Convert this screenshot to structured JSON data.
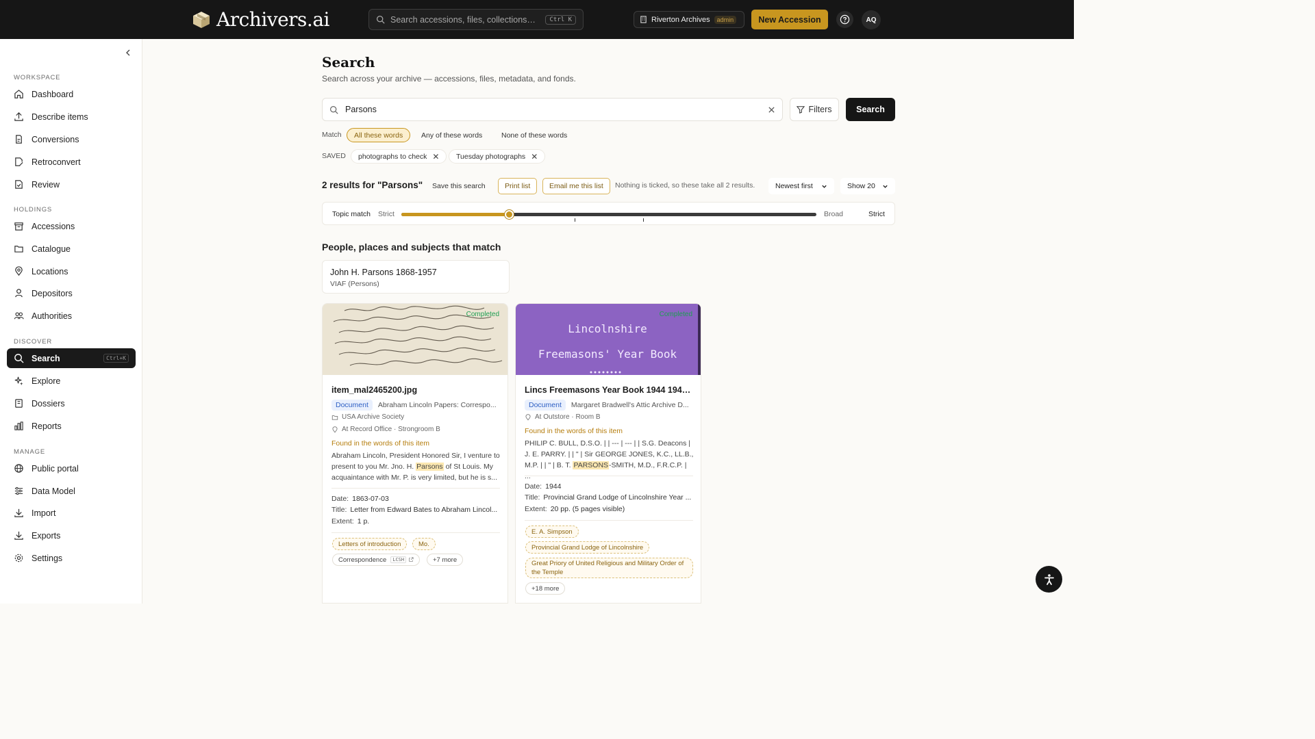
{
  "brand": {
    "name": "Archivers.ai"
  },
  "topbar": {
    "search_placeholder": "Search accessions, files, collections…",
    "search_shortcut": "Ctrl K",
    "org_name": "Riverton Archives",
    "org_role": "admin",
    "new_accession_label": "New Accession",
    "avatar_initials": "AQ"
  },
  "sidebar": {
    "sections": {
      "workspace": "WORKSPACE",
      "holdings": "HOLDINGS",
      "discover": "DISCOVER",
      "manage": "MANAGE"
    },
    "items": {
      "dashboard": "Dashboard",
      "describe": "Describe items",
      "conversions": "Conversions",
      "retroconvert": "Retroconvert",
      "review": "Review",
      "accessions": "Accessions",
      "catalogue": "Catalogue",
      "locations": "Locations",
      "depositors": "Depositors",
      "authorities": "Authorities",
      "search": "Search",
      "search_shortcut": "Ctrl+K",
      "explore": "Explore",
      "dossiers": "Dossiers",
      "reports": "Reports",
      "public_portal": "Public portal",
      "data_model": "Data Model",
      "import": "Import",
      "exports": "Exports",
      "settings": "Settings"
    }
  },
  "page": {
    "title": "Search",
    "subtitle": "Search across your archive — accessions, files, metadata, and fonds.",
    "query": "Parsons",
    "filters_label": "Filters",
    "search_label": "Search",
    "match_label": "Match",
    "match_options": [
      "All these words",
      "Any of these words",
      "None of these words"
    ],
    "saved_label": "SAVED",
    "saved_searches": [
      "photographs to check",
      "Tuesday photographs"
    ],
    "results_heading": "2 results for \"Parsons\"",
    "save_search_label": "Save this search",
    "print_list_label": "Print list",
    "email_list_label": "Email me this list",
    "selection_note": "Nothing is ticked, so these take all 2 results.",
    "sort_value": "Newest first",
    "page_size_value": "Show 20",
    "topic_match": {
      "label": "Topic match",
      "left_label": "Strict",
      "right_label": "Broad",
      "value_label": "Strict",
      "value_fraction": 0.26
    },
    "entities_heading": "People, places and subjects that match",
    "entity": {
      "name": "John H. Parsons 1868-1957",
      "source": "VIAF (Persons)"
    }
  },
  "results": [
    {
      "status": "Completed",
      "filename": "item_mal2465200.jpg",
      "type": "Document",
      "collection": "Abraham Lincoln Papers: Correspo...",
      "institution": "USA Archive Society",
      "location": "At Record Office · Strongroom B",
      "found_label": "Found in the words of this item",
      "snippet_before": "Abraham Lincoln, President Honored Sir, I venture to present to you Mr. Jno. H. ",
      "snippet_match": "Parsons",
      "snippet_after": " of St Louis. My acquaintance with Mr. P. is very limited, but he is s...",
      "date_label": "Date:",
      "date": "1863-07-03",
      "title_label": "Title:",
      "title": "Letter from Edward Bates to Abraham Lincol...",
      "extent_label": "Extent:",
      "extent": "1 p.",
      "tags": [
        "Letters of introduction",
        "Mo."
      ],
      "subject_tag": "Correspondence",
      "subject_source": "LCSH",
      "more_tags": "+7 more"
    },
    {
      "status": "Completed",
      "cover_line1": "Lincolnshire",
      "cover_line2": "Freemasons' Year Book",
      "filename": "Lincs Freemasons Year Book 1944 1945.tif",
      "type": "Document",
      "collection": "Margaret Bradwell's Attic Archive D...",
      "location": "At Outstore · Room B",
      "found_label": "Found in the words of this item",
      "snippet_before": "PHILIP C. BULL, D.S.O. | | --- | --- | | S.G. Deacons | J. E. PARRY. | | \" | Sir GEORGE JONES, K.C., LL.B., M.P. | | \" | B. T. ",
      "snippet_match": "PARSONS",
      "snippet_after": "-SMITH, M.D., F.R.C.P. | ...",
      "date_label": "Date:",
      "date": "1944",
      "title_label": "Title:",
      "title": "Provincial Grand Lodge of Lincolnshire Year ...",
      "extent_label": "Extent:",
      "extent": "20 pp. (5 pages visible)",
      "tags": [
        "E. A. Simpson",
        "Provincial Grand Lodge of Lincolnshire",
        "Great Priory of United Religious and Military Order of the Temple"
      ],
      "more_tags": "+18 more"
    }
  ],
  "colors": {
    "accent": "#c8961f",
    "topbar": "#161616",
    "badge_blue": "#2d5fc4",
    "status_green": "#1e9e52"
  },
  "icons": {
    "search": "search-icon",
    "clear": "close-icon",
    "filter": "filter-icon",
    "help": "help-icon",
    "accessibility": "accessibility-icon"
  }
}
